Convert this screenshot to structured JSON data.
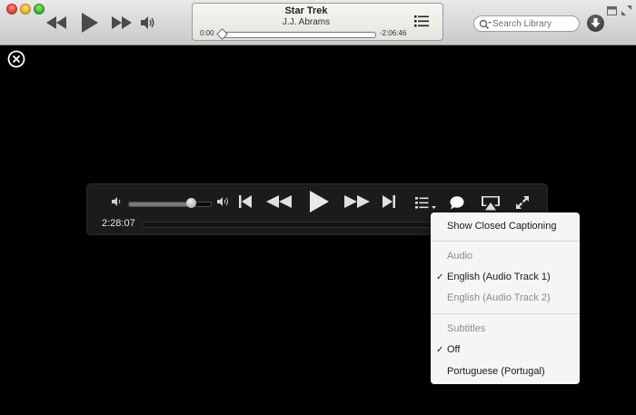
{
  "now_playing": {
    "title": "Star Trek",
    "artist": "J.J. Abrams",
    "elapsed": "0:00",
    "remaining": "-2:06:46",
    "progress": 0.0
  },
  "search": {
    "placeholder": "Search Library"
  },
  "video_controls": {
    "time": "2:28:07",
    "volume_level": 0.75,
    "playback_progress": 0.0
  },
  "captions_menu": {
    "show_captioning": "Show Closed Captioning",
    "audio_header": "Audio",
    "audio_tracks": [
      {
        "label": "English (Audio Track 1)",
        "checked": true,
        "enabled": true
      },
      {
        "label": "English (Audio Track 2)",
        "checked": false,
        "enabled": false
      }
    ],
    "subtitles_header": "Subtitles",
    "subtitles": [
      {
        "label": "Off",
        "checked": true
      },
      {
        "label": "Portuguese (Portugal)",
        "checked": false
      }
    ],
    "check_mark": "✓"
  },
  "icons": {
    "toolbar": [
      "rewind-icon",
      "play-icon",
      "fast-forward-icon",
      "volume-icon",
      "list-icon",
      "search-icon",
      "download-icon",
      "mini-player-icon",
      "fullscreen-icon"
    ],
    "video": [
      "close-icon",
      "volume-low-icon",
      "volume-high-icon",
      "skip-back-icon",
      "rewind-icon",
      "play-icon",
      "fast-forward-icon",
      "skip-forward-icon",
      "chapters-icon",
      "captions-icon",
      "airplay-icon",
      "fullscreen-icon"
    ]
  }
}
